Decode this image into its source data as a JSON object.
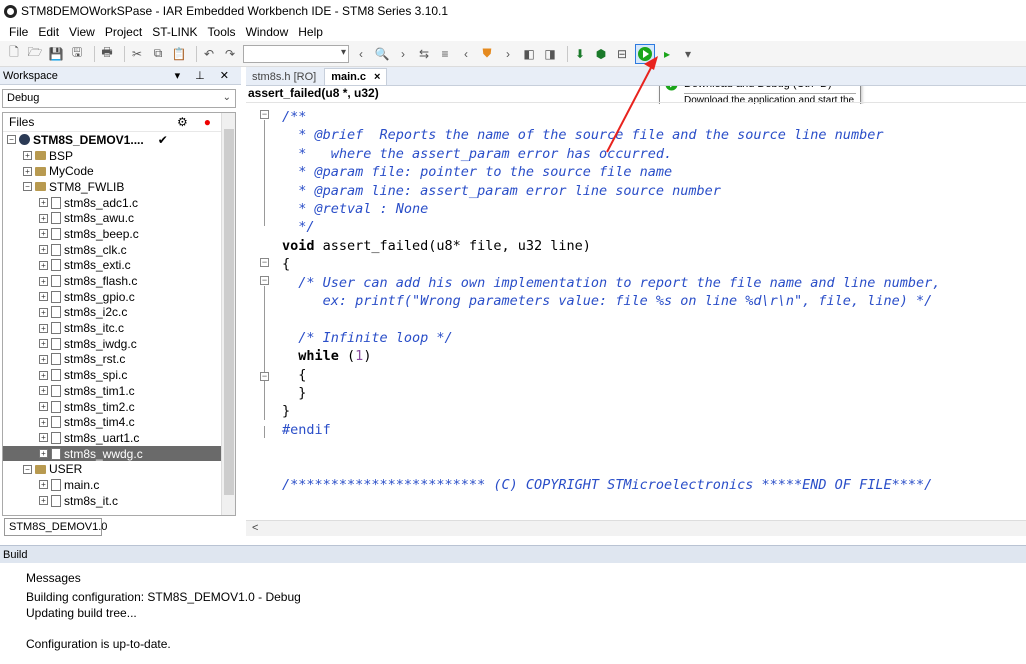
{
  "window": {
    "title": "STM8DEMOWorkSPase - IAR Embedded Workbench IDE - STM8 Series 3.10.1"
  },
  "menu": [
    "File",
    "Edit",
    "View",
    "Project",
    "ST-LINK",
    "Tools",
    "Window",
    "Help"
  ],
  "workspace": {
    "title": "Workspace",
    "config": "Debug",
    "files_header": "Files",
    "tab": "STM8S_DEMOV1.0",
    "tree": [
      {
        "label": "STM8S_DEMOV1....",
        "type": "project",
        "level": 0,
        "bold": true,
        "check": true
      },
      {
        "label": "BSP",
        "type": "folder",
        "level": 1
      },
      {
        "label": "MyCode",
        "type": "folder",
        "level": 1
      },
      {
        "label": "STM8_FWLIB",
        "type": "folder",
        "level": 1,
        "expanded": true
      },
      {
        "label": "stm8s_adc1.c",
        "type": "file",
        "level": 2
      },
      {
        "label": "stm8s_awu.c",
        "type": "file",
        "level": 2
      },
      {
        "label": "stm8s_beep.c",
        "type": "file",
        "level": 2
      },
      {
        "label": "stm8s_clk.c",
        "type": "file",
        "level": 2
      },
      {
        "label": "stm8s_exti.c",
        "type": "file",
        "level": 2
      },
      {
        "label": "stm8s_flash.c",
        "type": "file",
        "level": 2
      },
      {
        "label": "stm8s_gpio.c",
        "type": "file",
        "level": 2
      },
      {
        "label": "stm8s_i2c.c",
        "type": "file",
        "level": 2
      },
      {
        "label": "stm8s_itc.c",
        "type": "file",
        "level": 2
      },
      {
        "label": "stm8s_iwdg.c",
        "type": "file",
        "level": 2
      },
      {
        "label": "stm8s_rst.c",
        "type": "file",
        "level": 2
      },
      {
        "label": "stm8s_spi.c",
        "type": "file",
        "level": 2
      },
      {
        "label": "stm8s_tim1.c",
        "type": "file",
        "level": 2
      },
      {
        "label": "stm8s_tim2.c",
        "type": "file",
        "level": 2
      },
      {
        "label": "stm8s_tim4.c",
        "type": "file",
        "level": 2
      },
      {
        "label": "stm8s_uart1.c",
        "type": "file",
        "level": 2
      },
      {
        "label": "stm8s_wwdg.c",
        "type": "file",
        "level": 2,
        "selected": true
      },
      {
        "label": "USER",
        "type": "folder",
        "level": 1,
        "expanded": true
      },
      {
        "label": "main.c",
        "type": "file",
        "level": 2
      },
      {
        "label": "stm8s_it.c",
        "type": "file",
        "level": 2
      }
    ]
  },
  "editor": {
    "tabs": [
      {
        "label": "stm8s.h [RO]",
        "active": false
      },
      {
        "label": "main.c",
        "active": true
      }
    ],
    "close_glyph": "×",
    "function_bar": "assert_failed(u8 *, u32)",
    "lines": [
      {
        "text": "/**",
        "cls": "c-comment"
      },
      {
        "text": "  * @brief  Reports the name of the source file and the source line number",
        "cls": "c-comment"
      },
      {
        "text": "  *   where the assert_param error has occurred.",
        "cls": "c-comment"
      },
      {
        "text": "  * @param file: pointer to the source file name",
        "cls": "c-comment"
      },
      {
        "text": "  * @param line: assert_param error line source number",
        "cls": "c-comment"
      },
      {
        "text": "  * @retval : None",
        "cls": "c-comment"
      },
      {
        "text": "  */",
        "cls": "c-comment"
      },
      {
        "text": "void assert_failed(u8* file, u32 line)",
        "cls": "c-func"
      },
      {
        "text": "{",
        "cls": ""
      },
      {
        "text": "  /* User can add his own implementation to report the file name and line number,",
        "cls": "c-comment"
      },
      {
        "text": "     ex: printf(\"Wrong parameters value: file %s on line %d\\r\\n\", file, line) */",
        "cls": "c-comment"
      },
      {
        "text": "",
        "cls": ""
      },
      {
        "text": "  /* Infinite loop */",
        "cls": "c-comment"
      },
      {
        "text": "  while (1)",
        "cls": "c-while"
      },
      {
        "text": "  {",
        "cls": ""
      },
      {
        "text": "  }",
        "cls": ""
      },
      {
        "text": "}",
        "cls": ""
      },
      {
        "text": "#endif",
        "cls": "c-pp"
      },
      {
        "text": "",
        "cls": ""
      },
      {
        "text": "",
        "cls": ""
      },
      {
        "text": "/************************ (C) COPYRIGHT STMicroelectronics *****END OF FILE****/",
        "cls": "c-comment"
      }
    ]
  },
  "tooltip": {
    "title": "Download and Debug (Ctrl+D)",
    "description": "Download the application and start the debugger"
  },
  "build": {
    "title": "Build",
    "messages": [
      "Messages",
      "Building configuration: STM8S_DEMOV1.0 - Debug",
      "Updating build tree...",
      "",
      "Configuration is up-to-date."
    ]
  },
  "colors": {
    "accent_blue": "#2c7ae0",
    "debug_green": "#1aa51a",
    "annotation_red": "#e8231e",
    "comment_blue": "#2a4ec8"
  }
}
